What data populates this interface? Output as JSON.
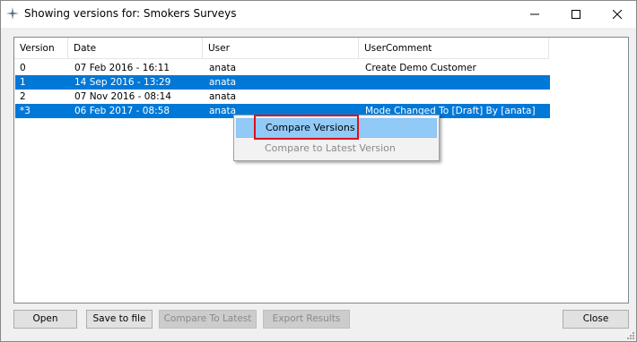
{
  "window": {
    "title": "Showing versions for: Smokers Surveys"
  },
  "table": {
    "columns": [
      "Version",
      "Date",
      "User",
      "UserComment"
    ],
    "rows": [
      {
        "version": "0",
        "date": "07 Feb 2016 - 16:11",
        "user": "anata",
        "comment": "Create Demo Customer",
        "selected": false
      },
      {
        "version": "1",
        "date": "14 Sep 2016 - 13:29",
        "user": "anata",
        "comment": "",
        "selected": true
      },
      {
        "version": "2",
        "date": "07 Nov 2016 - 08:14",
        "user": "anata",
        "comment": "",
        "selected": false
      },
      {
        "version": "*3",
        "date": "06 Feb 2017 - 08:58",
        "user": "anata",
        "comment": "Mode Changed To [Draft] By [anata]",
        "selected": true
      }
    ]
  },
  "context_menu": {
    "items": [
      {
        "label": "Compare Versions",
        "enabled": true
      },
      {
        "label": "Compare to Latest Version",
        "enabled": false
      }
    ]
  },
  "buttons": {
    "open": "Open",
    "save": "Save to file",
    "compare_latest": "Compare To Latest",
    "export": "Export Results",
    "close": "Close"
  },
  "colors": {
    "selection": "#0078d7",
    "menu_hover": "#91c9f7",
    "highlight_box": "#e0101a"
  }
}
